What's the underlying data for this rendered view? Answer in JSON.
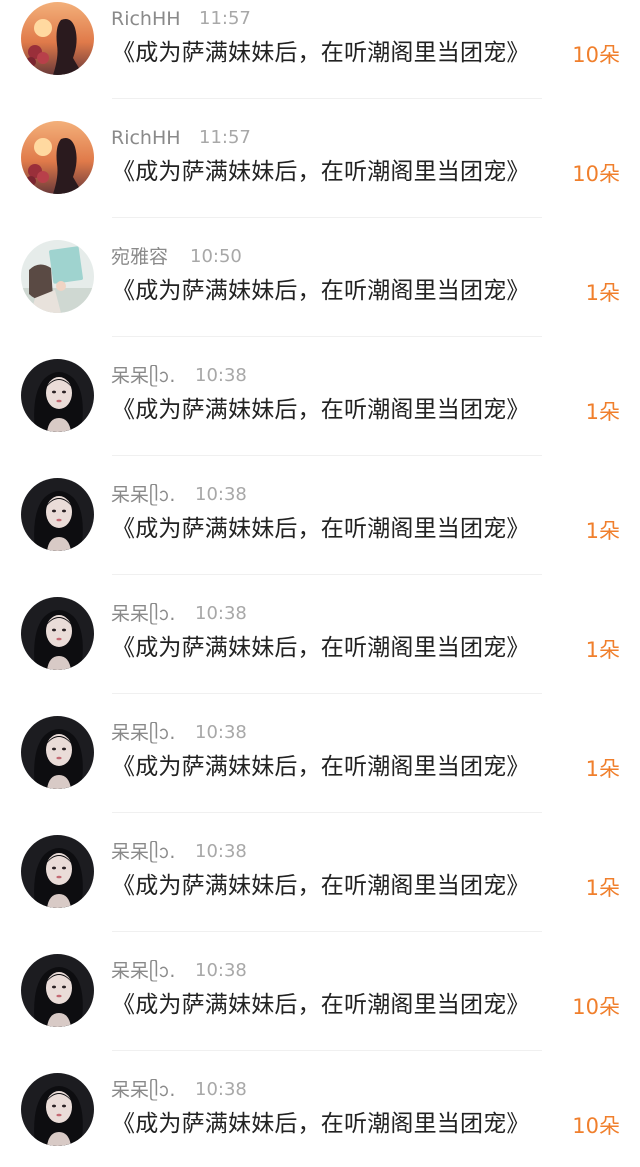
{
  "colors": {
    "name": "#8a8a8a",
    "time": "#a8a8a8",
    "title": "#222222",
    "gift_accent": "#f07f2c",
    "divider": "#f0f0f0"
  },
  "feed": {
    "items": [
      {
        "name": "RichHH",
        "time": "11:57",
        "title": "《成为萨满妹妹后，在听潮阁里当团宠》",
        "gift": "10朵",
        "avatar": "sunset-girl-avatar"
      },
      {
        "name": "RichHH",
        "time": "11:57",
        "title": "《成为萨满妹妹后，在听潮阁里当团宠》",
        "gift": "10朵",
        "avatar": "sunset-girl-avatar"
      },
      {
        "name": "宛雅容",
        "time": "10:50",
        "title": "《成为萨满妹妹后，在听潮阁里当团宠》",
        "gift": "1朵",
        "avatar": "book-reader-avatar"
      },
      {
        "name": "呆呆ᥫᩣ.",
        "time": "10:38",
        "title": "《成为萨满妹妹后，在听潮阁里当团宠》",
        "gift": "1朵",
        "avatar": "dark-hair-girl-avatar"
      },
      {
        "name": "呆呆ᥫᩣ.",
        "time": "10:38",
        "title": "《成为萨满妹妹后，在听潮阁里当团宠》",
        "gift": "1朵",
        "avatar": "dark-hair-girl-avatar"
      },
      {
        "name": "呆呆ᥫᩣ.",
        "time": "10:38",
        "title": "《成为萨满妹妹后，在听潮阁里当团宠》",
        "gift": "1朵",
        "avatar": "dark-hair-girl-avatar"
      },
      {
        "name": "呆呆ᥫᩣ.",
        "time": "10:38",
        "title": "《成为萨满妹妹后，在听潮阁里当团宠》",
        "gift": "1朵",
        "avatar": "dark-hair-girl-avatar"
      },
      {
        "name": "呆呆ᥫᩣ.",
        "time": "10:38",
        "title": "《成为萨满妹妹后，在听潮阁里当团宠》",
        "gift": "1朵",
        "avatar": "dark-hair-girl-avatar"
      },
      {
        "name": "呆呆ᥫᩣ.",
        "time": "10:38",
        "title": "《成为萨满妹妹后，在听潮阁里当团宠》",
        "gift": "10朵",
        "avatar": "dark-hair-girl-avatar"
      },
      {
        "name": "呆呆ᥫᩣ.",
        "time": "10:38",
        "title": "《成为萨满妹妹后，在听潮阁里当团宠》",
        "gift": "10朵",
        "avatar": "dark-hair-girl-avatar"
      }
    ]
  }
}
